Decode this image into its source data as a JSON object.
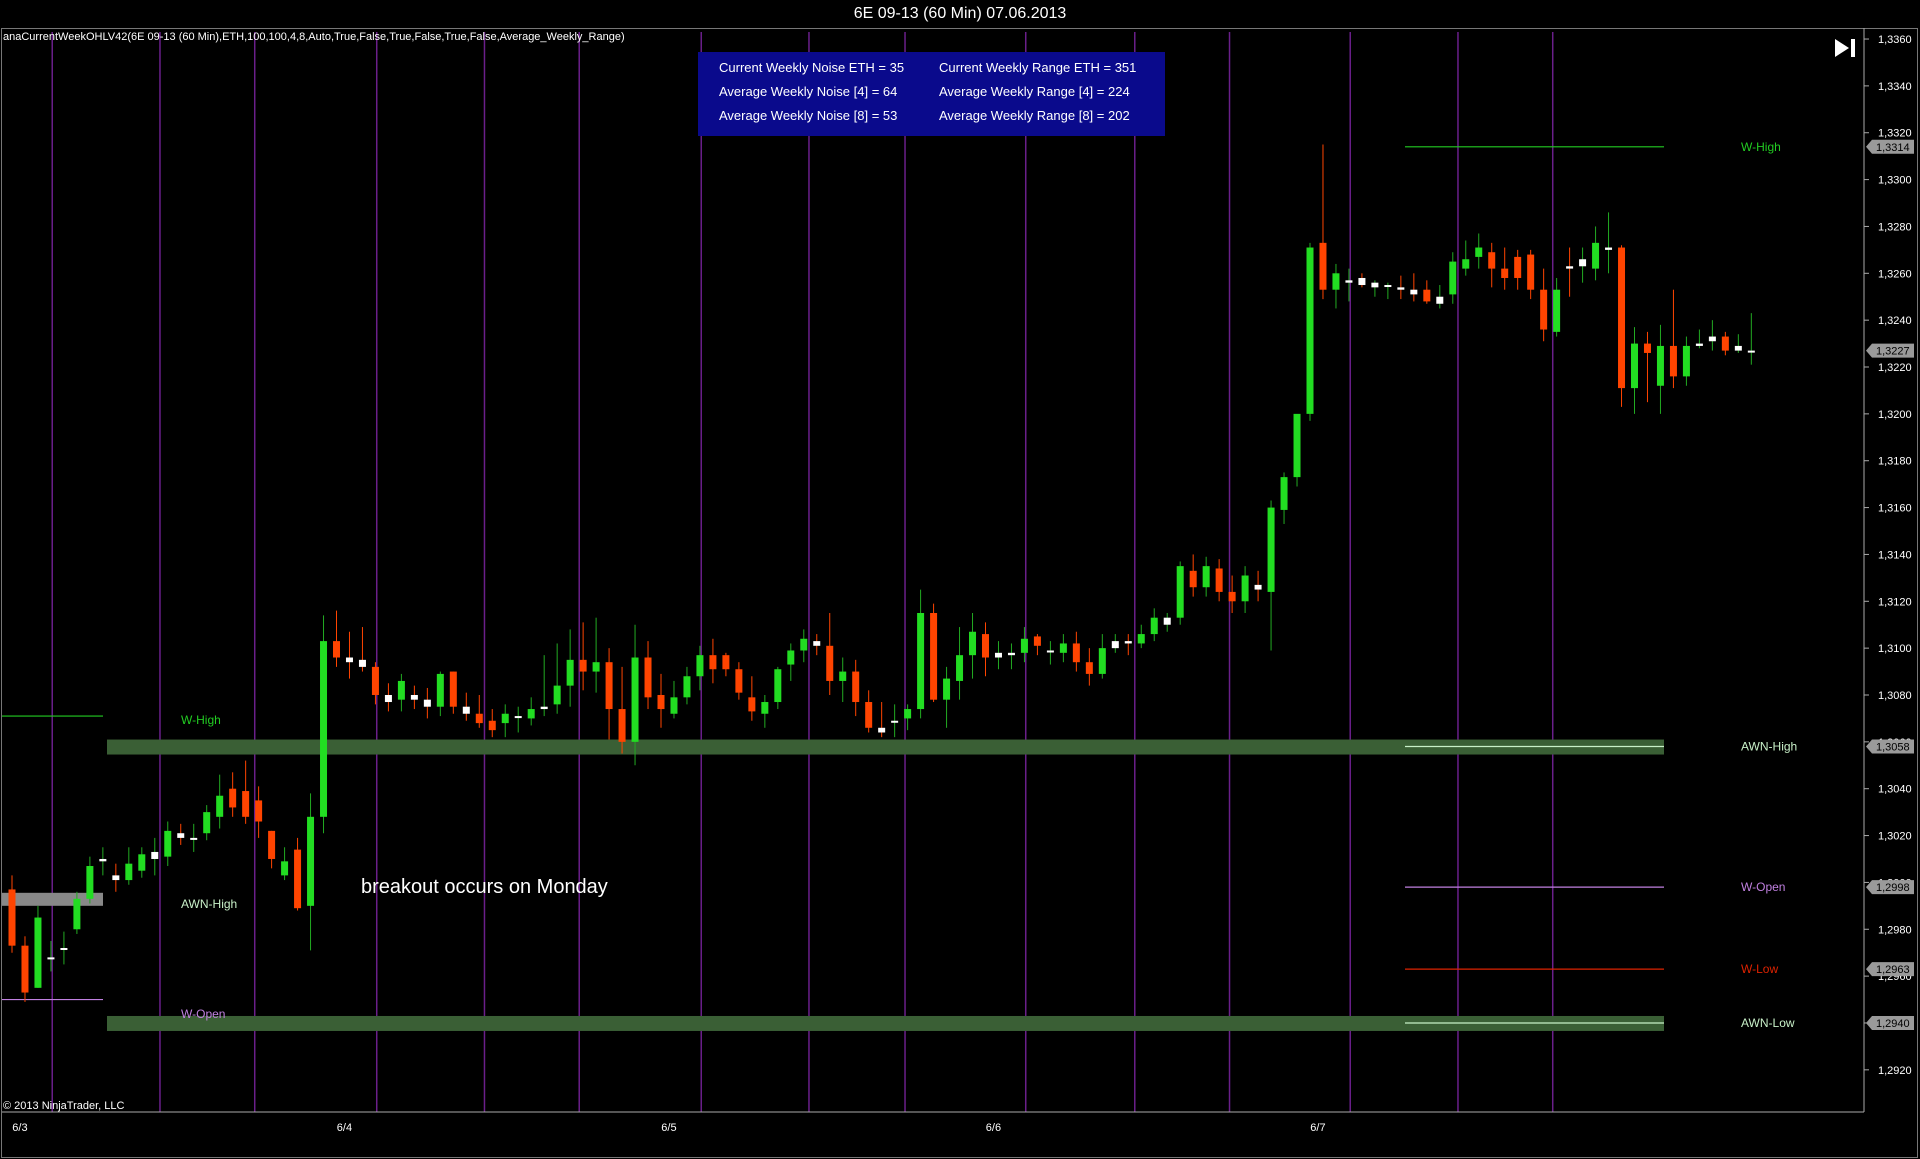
{
  "window": {
    "title": "6E 09-13 (60 Min)  07.06.2013"
  },
  "indicator_label": "anaCurrentWeekOHLV42(6E 09-13 (60 Min),ETH,100,100,4,8,Auto,True,False,True,False,True,False,Average_Weekly_Range)",
  "copyright": "© 2013 NinjaTrader, LLC",
  "info_box": {
    "current_noise": "Current Weekly Noise ETH = 35",
    "avg_noise_4": "Average Weekly Noise [4] = 64",
    "avg_noise_8": "Average Weekly Noise [8] = 53",
    "current_range": "Current Weekly Range ETH = 351",
    "avg_range_4": "Average Weekly Range [4] = 224",
    "avg_range_8": "Average Weekly Range [8] = 202"
  },
  "annotation": "breakout occurs on Monday",
  "icons": {
    "end": "jump-to-end-icon"
  },
  "colors": {
    "up": "#22dd22",
    "down": "#ff4400",
    "bar_line_up": "#22aa22",
    "session_line": "#6a1f8a",
    "band": "#3a5f35",
    "w_high": "#22cc22",
    "awn": "#c8f0c8",
    "w_open": "#c080e0",
    "w_low": "#dd2200",
    "info_bg": "#0a0a8c"
  },
  "chart_data": {
    "type": "candlestick",
    "symbol": "6E 09-13",
    "timeframe": "60 Min",
    "ylim": [
      1.2902,
      1.3363
    ],
    "y_ticks": [
      "1,3360",
      "1,3340",
      "1,3320",
      "1,3300",
      "1,3280",
      "1,3260",
      "1,3240",
      "1,3220",
      "1,3200",
      "1,3180",
      "1,3160",
      "1,3140",
      "1,3120",
      "1,3100",
      "1,3080",
      "1,3060",
      "1,3040",
      "1,3020",
      "1,3000",
      "1,2980",
      "1,2960",
      "1,2940",
      "1,2920"
    ],
    "y_tick_values": [
      1.336,
      1.334,
      1.332,
      1.33,
      1.328,
      1.326,
      1.324,
      1.322,
      1.32,
      1.318,
      1.316,
      1.314,
      1.312,
      1.31,
      1.308,
      1.306,
      1.304,
      1.302,
      1.3,
      1.298,
      1.296,
      1.294,
      1.292
    ],
    "x_labels": [
      {
        "label": "6/3",
        "bar": 4
      },
      {
        "label": "6/4",
        "bar": 29
      },
      {
        "label": "6/5",
        "bar": 54
      },
      {
        "label": "6/6",
        "bar": 79
      },
      {
        "label": "6/7",
        "bar": 104
      }
    ],
    "session_separators": [
      3.1,
      11.4,
      18.7,
      28.1,
      36.4,
      43.7,
      53.1,
      61.4,
      68.8,
      78.1,
      86.5,
      93.8,
      103.1,
      111.4,
      118.7
    ],
    "price_flags": [
      {
        "label": "1,3314",
        "value": 1.3314,
        "color": "#aaaaaa"
      },
      {
        "label": "1,3227",
        "value": 1.3227,
        "color": "#aaaaaa"
      },
      {
        "label": "1,3058",
        "value": 1.3058,
        "color": "#aaaaaa"
      },
      {
        "label": "1,2998",
        "value": 1.2998,
        "color": "#aaaaaa"
      },
      {
        "label": "1,2963",
        "value": 1.2963,
        "color": "#aaaaaa"
      },
      {
        "label": "1,2940",
        "value": 1.294,
        "color": "#aaaaaa"
      }
    ],
    "levels_left": [
      {
        "name": "W-High",
        "value": 1.3071,
        "label": "W-High",
        "color": "#22cc22",
        "type": "line"
      },
      {
        "name": "AWN-High",
        "value": 1.2993,
        "label": "AWN-High",
        "color": "#c8f0c8",
        "type": "band"
      },
      {
        "name": "W-Open",
        "value": 1.295,
        "label": "W-Open",
        "color": "#c080e0",
        "type": "line"
      }
    ],
    "levels_right": [
      {
        "name": "W-High",
        "value": 1.3314,
        "label": "W-High",
        "color": "#22cc22",
        "type": "line"
      },
      {
        "name": "AWN-High",
        "value": 1.3058,
        "label": "AWN-High",
        "color": "#c8f0c8",
        "type": "band"
      },
      {
        "name": "W-Open",
        "value": 1.2998,
        "label": "W-Open",
        "color": "#c080e0",
        "type": "line"
      },
      {
        "name": "W-Low",
        "value": 1.2963,
        "label": "W-Low",
        "color": "#dd2200",
        "type": "line"
      },
      {
        "name": "AWN-Low",
        "value": 1.294,
        "label": "AWN-Low",
        "color": "#c8f0c8",
        "type": "band"
      }
    ],
    "candles": [
      [
        1.2997,
        1.3003,
        1.297,
        1.2973
      ],
      [
        1.2973,
        1.2977,
        1.2949,
        1.2953
      ],
      [
        1.2955,
        1.299,
        1.2955,
        1.2985
      ],
      [
        1.2968,
        1.2975,
        1.2962,
        1.2968
      ],
      [
        1.2972,
        1.2979,
        1.2965,
        1.2972
      ],
      [
        1.298,
        1.2996,
        1.2978,
        1.2993
      ],
      [
        1.2993,
        1.3011,
        1.2991,
        1.3007
      ],
      [
        1.3009,
        1.3015,
        1.3003,
        1.301
      ],
      [
        1.3003,
        1.3008,
        1.2996,
        1.3001
      ],
      [
        1.3001,
        1.3015,
        1.2999,
        1.3008
      ],
      [
        1.3005,
        1.3015,
        1.3002,
        1.3012
      ],
      [
        1.301,
        1.3019,
        1.3003,
        1.3013
      ],
      [
        1.3011,
        1.3026,
        1.3007,
        1.3022
      ],
      [
        1.3021,
        1.3025,
        1.3016,
        1.3019
      ],
      [
        1.3019,
        1.3025,
        1.3013,
        1.3019
      ],
      [
        1.3021,
        1.3033,
        1.3018,
        1.303
      ],
      [
        1.3028,
        1.3046,
        1.3023,
        1.3037
      ],
      [
        1.304,
        1.3047,
        1.3028,
        1.3032
      ],
      [
        1.3039,
        1.3052,
        1.3025,
        1.3028
      ],
      [
        1.3035,
        1.3041,
        1.3019,
        1.3026
      ],
      [
        1.3022,
        1.3022,
        1.3006,
        1.301
      ],
      [
        1.3003,
        1.3015,
        1.3001,
        1.3009
      ],
      [
        1.3014,
        1.3019,
        1.2988,
        1.2989
      ],
      [
        1.299,
        1.3038,
        1.2971,
        1.3028
      ],
      [
        1.3028,
        1.3114,
        1.3021,
        1.3103
      ],
      [
        1.3103,
        1.3116,
        1.3092,
        1.3096
      ],
      [
        1.3096,
        1.3107,
        1.3087,
        1.3094
      ],
      [
        1.3095,
        1.3109,
        1.309,
        1.3092
      ],
      [
        1.3092,
        1.3094,
        1.3076,
        1.308
      ],
      [
        1.308,
        1.3085,
        1.3073,
        1.3077
      ],
      [
        1.3078,
        1.3089,
        1.3073,
        1.3086
      ],
      [
        1.308,
        1.3084,
        1.3074,
        1.3078
      ],
      [
        1.3078,
        1.3083,
        1.307,
        1.3075
      ],
      [
        1.3075,
        1.309,
        1.3071,
        1.3089
      ],
      [
        1.309,
        1.309,
        1.3072,
        1.3075
      ],
      [
        1.3075,
        1.3081,
        1.3069,
        1.3072
      ],
      [
        1.3072,
        1.308,
        1.3066,
        1.3068
      ],
      [
        1.3069,
        1.3074,
        1.3062,
        1.3065
      ],
      [
        1.3068,
        1.3076,
        1.3062,
        1.3072
      ],
      [
        1.3071,
        1.3075,
        1.3064,
        1.3071
      ],
      [
        1.307,
        1.3079,
        1.3067,
        1.3074
      ],
      [
        1.3074,
        1.3097,
        1.3071,
        1.3075
      ],
      [
        1.3076,
        1.3102,
        1.3072,
        1.3084
      ],
      [
        1.3084,
        1.3108,
        1.3075,
        1.3095
      ],
      [
        1.3095,
        1.3111,
        1.3082,
        1.309
      ],
      [
        1.309,
        1.3113,
        1.3081,
        1.3094
      ],
      [
        1.3094,
        1.31,
        1.3061,
        1.3074
      ],
      [
        1.3074,
        1.3092,
        1.3055,
        1.306
      ],
      [
        1.306,
        1.311,
        1.305,
        1.3096
      ],
      [
        1.3096,
        1.3103,
        1.3074,
        1.3079
      ],
      [
        1.308,
        1.3089,
        1.3066,
        1.3074
      ],
      [
        1.3072,
        1.3086,
        1.307,
        1.3079
      ],
      [
        1.3079,
        1.3092,
        1.3076,
        1.3088
      ],
      [
        1.3088,
        1.3101,
        1.3082,
        1.3097
      ],
      [
        1.3097,
        1.3104,
        1.3085,
        1.3091
      ],
      [
        1.3097,
        1.3098,
        1.3088,
        1.3091
      ],
      [
        1.3091,
        1.3094,
        1.3078,
        1.3081
      ],
      [
        1.3079,
        1.3088,
        1.3069,
        1.3073
      ],
      [
        1.3072,
        1.308,
        1.3066,
        1.3077
      ],
      [
        1.3077,
        1.3092,
        1.3074,
        1.3091
      ],
      [
        1.3093,
        1.3102,
        1.3086,
        1.3099
      ],
      [
        1.3099,
        1.3108,
        1.3094,
        1.3104
      ],
      [
        1.3103,
        1.3106,
        1.3097,
        1.3101
      ],
      [
        1.3101,
        1.3115,
        1.308,
        1.3086
      ],
      [
        1.3086,
        1.3096,
        1.3077,
        1.309
      ],
      [
        1.309,
        1.3095,
        1.3071,
        1.3077
      ],
      [
        1.3077,
        1.3082,
        1.3064,
        1.3066
      ],
      [
        1.3066,
        1.3077,
        1.3062,
        1.3064
      ],
      [
        1.3069,
        1.3076,
        1.3062,
        1.3069
      ],
      [
        1.307,
        1.3076,
        1.3065,
        1.3074
      ],
      [
        1.3074,
        1.3125,
        1.307,
        1.3115
      ],
      [
        1.3115,
        1.3119,
        1.3077,
        1.3078
      ],
      [
        1.3078,
        1.3092,
        1.3066,
        1.3087
      ],
      [
        1.3086,
        1.3109,
        1.3078,
        1.3097
      ],
      [
        1.3097,
        1.3115,
        1.3087,
        1.3107
      ],
      [
        1.3106,
        1.3111,
        1.3088,
        1.3096
      ],
      [
        1.3096,
        1.3103,
        1.3091,
        1.3098
      ],
      [
        1.3097,
        1.3102,
        1.3091,
        1.3098
      ],
      [
        1.3098,
        1.3109,
        1.3094,
        1.3104
      ],
      [
        1.3105,
        1.3106,
        1.3097,
        1.3101
      ],
      [
        1.3099,
        1.3103,
        1.3093,
        1.3099
      ],
      [
        1.3098,
        1.3106,
        1.3094,
        1.3102
      ],
      [
        1.3102,
        1.3107,
        1.309,
        1.3094
      ],
      [
        1.3094,
        1.31,
        1.3084,
        1.3089
      ],
      [
        1.3089,
        1.3106,
        1.3087,
        1.31
      ],
      [
        1.31,
        1.3106,
        1.3098,
        1.3103
      ],
      [
        1.3103,
        1.3106,
        1.3097,
        1.3102
      ],
      [
        1.3102,
        1.311,
        1.31,
        1.3106
      ],
      [
        1.3106,
        1.3117,
        1.3103,
        1.3113
      ],
      [
        1.311,
        1.3115,
        1.3107,
        1.3113
      ],
      [
        1.3113,
        1.3137,
        1.311,
        1.3135
      ],
      [
        1.3133,
        1.314,
        1.3122,
        1.3126
      ],
      [
        1.3126,
        1.3139,
        1.3122,
        1.3135
      ],
      [
        1.3134,
        1.3138,
        1.312,
        1.3124
      ],
      [
        1.3124,
        1.3131,
        1.3115,
        1.312
      ],
      [
        1.312,
        1.3135,
        1.3115,
        1.3131
      ],
      [
        1.3127,
        1.3133,
        1.312,
        1.3125
      ],
      [
        1.3124,
        1.3163,
        1.3099,
        1.316
      ],
      [
        1.3159,
        1.3175,
        1.3153,
        1.3173
      ],
      [
        1.3173,
        1.3192,
        1.3169,
        1.32
      ],
      [
        1.32,
        1.3273,
        1.3197,
        1.3271
      ],
      [
        1.3273,
        1.3315,
        1.3249,
        1.3253
      ],
      [
        1.3253,
        1.3264,
        1.3245,
        1.326
      ],
      [
        1.3256,
        1.3262,
        1.3248,
        1.3257
      ],
      [
        1.3258,
        1.326,
        1.3254,
        1.3255
      ],
      [
        1.3254,
        1.3257,
        1.325,
        1.3256
      ],
      [
        1.3255,
        1.3256,
        1.3249,
        1.3255
      ],
      [
        1.3254,
        1.3259,
        1.3249,
        1.3253
      ],
      [
        1.3253,
        1.326,
        1.3248,
        1.3251
      ],
      [
        1.3253,
        1.3257,
        1.3247,
        1.3248
      ],
      [
        1.3247,
        1.3255,
        1.3245,
        1.325
      ],
      [
        1.3251,
        1.3269,
        1.3247,
        1.3265
      ],
      [
        1.3262,
        1.3274,
        1.3259,
        1.3266
      ],
      [
        1.3267,
        1.3277,
        1.3262,
        1.3271
      ],
      [
        1.3269,
        1.3273,
        1.3254,
        1.3262
      ],
      [
        1.3262,
        1.3271,
        1.3253,
        1.3258
      ],
      [
        1.3267,
        1.327,
        1.3253,
        1.3258
      ],
      [
        1.3268,
        1.327,
        1.3249,
        1.3253
      ],
      [
        1.3253,
        1.3262,
        1.3231,
        1.3236
      ],
      [
        1.3235,
        1.3258,
        1.3233,
        1.3253
      ],
      [
        1.3263,
        1.3271,
        1.325,
        1.3262
      ],
      [
        1.3263,
        1.3271,
        1.3256,
        1.3266
      ],
      [
        1.3262,
        1.328,
        1.3257,
        1.3273
      ],
      [
        1.327,
        1.3286,
        1.326,
        1.3271
      ],
      [
        1.3271,
        1.3272,
        1.3203,
        1.3211
      ],
      [
        1.3211,
        1.3237,
        1.32,
        1.323
      ],
      [
        1.323,
        1.3235,
        1.3205,
        1.3226
      ],
      [
        1.3212,
        1.3238,
        1.32,
        1.3229
      ],
      [
        1.3229,
        1.3253,
        1.3211,
        1.3216
      ],
      [
        1.3216,
        1.3233,
        1.3212,
        1.3229
      ],
      [
        1.3229,
        1.3236,
        1.3228,
        1.323
      ],
      [
        1.3231,
        1.324,
        1.3227,
        1.3233
      ],
      [
        1.3233,
        1.3235,
        1.3225,
        1.3227
      ],
      [
        1.3227,
        1.3234,
        1.3226,
        1.3229
      ],
      [
        1.3227,
        1.3243,
        1.3221,
        1.3227
      ]
    ]
  }
}
